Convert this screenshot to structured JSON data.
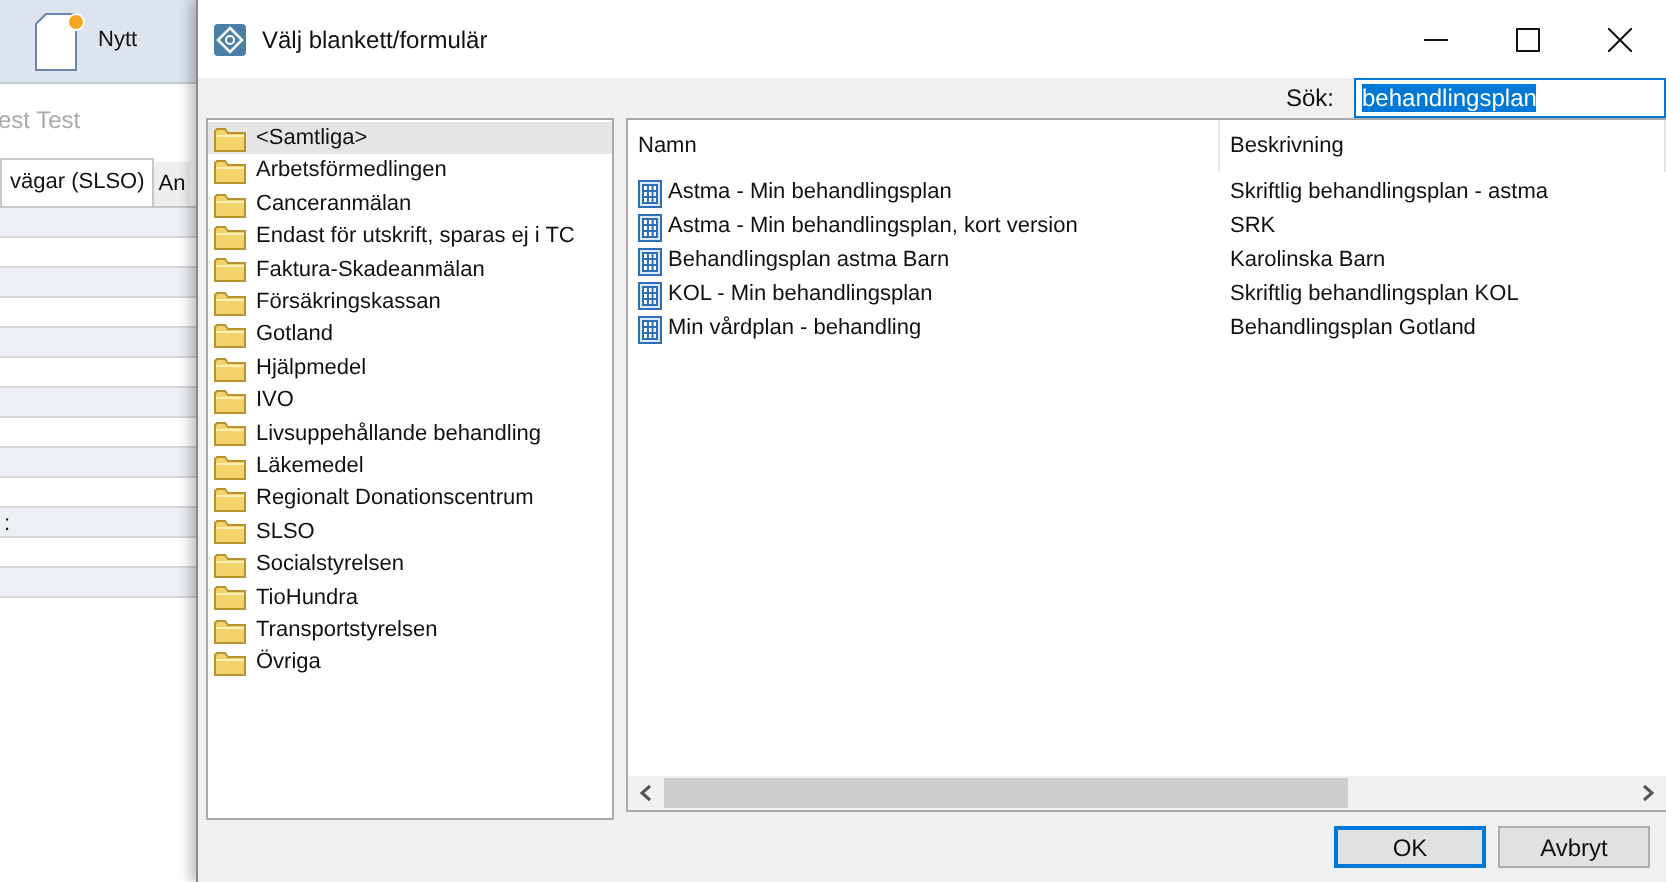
{
  "background_app": {
    "new_button": "Nytt",
    "title_fragment": "est Test",
    "tabs": [
      {
        "label": "vägar (SLSO)",
        "selected": true
      },
      {
        "label": "An",
        "selected": false
      }
    ],
    "label_fragment": ":"
  },
  "dialog": {
    "title": "Välj blankett/formulär",
    "search": {
      "label": "Sök:",
      "value": "behandlingsplan",
      "text_selected": true
    },
    "folders": [
      {
        "label": "<Samtliga>",
        "selected": true
      },
      {
        "label": "Arbetsförmedlingen",
        "selected": false
      },
      {
        "label": "Canceranmälan",
        "selected": false
      },
      {
        "label": "Endast för utskrift, sparas ej i TC",
        "selected": false
      },
      {
        "label": "Faktura-Skadeanmälan",
        "selected": false
      },
      {
        "label": "Försäkringskassan",
        "selected": false
      },
      {
        "label": "Gotland",
        "selected": false
      },
      {
        "label": "Hjälpmedel",
        "selected": false
      },
      {
        "label": "IVO",
        "selected": false
      },
      {
        "label": "Livsuppehållande behandling",
        "selected": false
      },
      {
        "label": "Läkemedel",
        "selected": false
      },
      {
        "label": "Regionalt Donationscentrum",
        "selected": false
      },
      {
        "label": "SLSO",
        "selected": false
      },
      {
        "label": "Socialstyrelsen",
        "selected": false
      },
      {
        "label": "TioHundra",
        "selected": false
      },
      {
        "label": "Transportstyrelsen",
        "selected": false
      },
      {
        "label": "Övriga",
        "selected": false
      }
    ],
    "columns": [
      "Namn",
      "Beskrivning"
    ],
    "rows": [
      {
        "name": "Astma - Min behandlingsplan",
        "description": "Skriftlig behandlingsplan - astma"
      },
      {
        "name": "Astma - Min behandlingsplan, kort version",
        "description": "SRK"
      },
      {
        "name": "Behandlingsplan astma Barn",
        "description": "Karolinska Barn"
      },
      {
        "name": "KOL - Min behandlingsplan",
        "description": "Skriftlig behandlingsplan KOL"
      },
      {
        "name": "Min vårdplan - behandling",
        "description": "Behandlingsplan Gotland"
      }
    ],
    "buttons": [
      {
        "label": "OK",
        "default": true
      },
      {
        "label": "Avbryt",
        "default": false
      }
    ]
  }
}
